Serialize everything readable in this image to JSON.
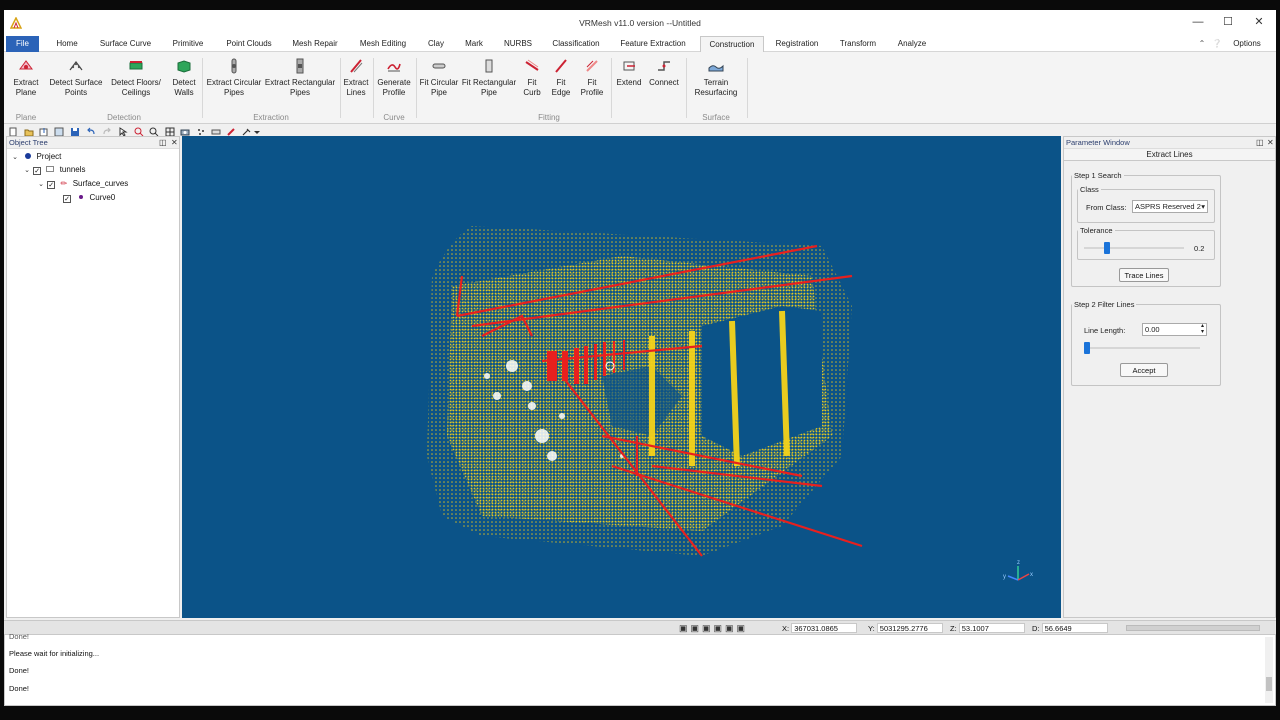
{
  "window": {
    "title": "VRMesh v11.0 version --Untitled"
  },
  "menu": {
    "file": "File",
    "tabs": [
      "Home",
      "Surface Curve",
      "Primitive",
      "Point Clouds",
      "Mesh Repair",
      "Mesh Editing",
      "Clay",
      "Mark",
      "NURBS",
      "Classification",
      "Feature Extraction",
      "Construction",
      "Registration",
      "Transform",
      "Analyze"
    ],
    "active_tab": "Construction",
    "options": "Options"
  },
  "ribbon": {
    "buttons": [
      {
        "label": "Extract\nPlane"
      },
      {
        "label": "Detect Surface\nPoints"
      },
      {
        "label": "Detect Floors/\nCeilings"
      },
      {
        "label": "Detect\nWalls"
      },
      {
        "label": "Extract Circular\nPipes"
      },
      {
        "label": "Extract Rectangular\nPipes"
      },
      {
        "label": "Extract\nLines"
      },
      {
        "label": "Generate\nProfile"
      },
      {
        "label": "Fit Circular\nPipe"
      },
      {
        "label": "Fit Rectangular\nPipe"
      },
      {
        "label": "Fit\nCurb"
      },
      {
        "label": "Fit\nEdge"
      },
      {
        "label": "Fit\nProfile"
      },
      {
        "label": "Extend"
      },
      {
        "label": "Connect"
      },
      {
        "label": "Terrain\nResurfacing"
      }
    ],
    "groups": [
      "Plane",
      "Detection",
      "Extraction",
      "Curve",
      "Fitting",
      "Surface"
    ]
  },
  "object_tree": {
    "title": "Object Tree",
    "items": [
      {
        "label": "Project"
      },
      {
        "label": "tunnels"
      },
      {
        "label": "Surface_curves"
      },
      {
        "label": "Curve0"
      }
    ]
  },
  "parameter_window": {
    "title": "Parameter Window",
    "subtitle": "Extract Lines",
    "step1": "Step 1 Search",
    "class_group": "Class",
    "from_class_label": "From Class:",
    "from_class_value": "ASPRS Reserved 2",
    "tolerance_group": "Tolerance",
    "tolerance_value": "0.2",
    "tolerance_level": 0.2,
    "trace_button": "Trace Lines",
    "step2": "Step 2  Filter Lines",
    "line_length_label": "Line Length:",
    "line_length_value": "0.00",
    "line_length_level": 0,
    "accept_button": "Accept"
  },
  "status": {
    "x_label": "X:",
    "x": "367031.0865",
    "y_label": "Y:",
    "y": "5031295.2776",
    "z_label": "Z:",
    "z": "53.1007",
    "d_label": "D:",
    "d": "56.6649"
  },
  "log": {
    "lines": [
      "Done!",
      "Please wait for initializing...",
      "Done!",
      "Done!"
    ]
  },
  "colors": {
    "viewport_bg": "#0b5388",
    "points": "#f5d31a",
    "lines": "#e8201e",
    "accent": "#2b63b8"
  }
}
